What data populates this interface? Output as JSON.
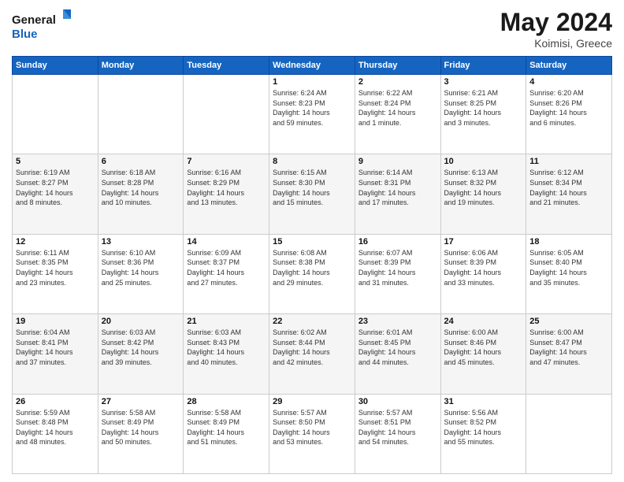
{
  "header": {
    "logo_line1": "General",
    "logo_line2": "Blue",
    "month_year": "May 2024",
    "location": "Koimisi, Greece"
  },
  "weekdays": [
    "Sunday",
    "Monday",
    "Tuesday",
    "Wednesday",
    "Thursday",
    "Friday",
    "Saturday"
  ],
  "weeks": [
    [
      {
        "day": "",
        "info": ""
      },
      {
        "day": "",
        "info": ""
      },
      {
        "day": "",
        "info": ""
      },
      {
        "day": "1",
        "info": "Sunrise: 6:24 AM\nSunset: 8:23 PM\nDaylight: 14 hours\nand 59 minutes."
      },
      {
        "day": "2",
        "info": "Sunrise: 6:22 AM\nSunset: 8:24 PM\nDaylight: 14 hours\nand 1 minute."
      },
      {
        "day": "3",
        "info": "Sunrise: 6:21 AM\nSunset: 8:25 PM\nDaylight: 14 hours\nand 3 minutes."
      },
      {
        "day": "4",
        "info": "Sunrise: 6:20 AM\nSunset: 8:26 PM\nDaylight: 14 hours\nand 6 minutes."
      }
    ],
    [
      {
        "day": "5",
        "info": "Sunrise: 6:19 AM\nSunset: 8:27 PM\nDaylight: 14 hours\nand 8 minutes."
      },
      {
        "day": "6",
        "info": "Sunrise: 6:18 AM\nSunset: 8:28 PM\nDaylight: 14 hours\nand 10 minutes."
      },
      {
        "day": "7",
        "info": "Sunrise: 6:16 AM\nSunset: 8:29 PM\nDaylight: 14 hours\nand 13 minutes."
      },
      {
        "day": "8",
        "info": "Sunrise: 6:15 AM\nSunset: 8:30 PM\nDaylight: 14 hours\nand 15 minutes."
      },
      {
        "day": "9",
        "info": "Sunrise: 6:14 AM\nSunset: 8:31 PM\nDaylight: 14 hours\nand 17 minutes."
      },
      {
        "day": "10",
        "info": "Sunrise: 6:13 AM\nSunset: 8:32 PM\nDaylight: 14 hours\nand 19 minutes."
      },
      {
        "day": "11",
        "info": "Sunrise: 6:12 AM\nSunset: 8:34 PM\nDaylight: 14 hours\nand 21 minutes."
      }
    ],
    [
      {
        "day": "12",
        "info": "Sunrise: 6:11 AM\nSunset: 8:35 PM\nDaylight: 14 hours\nand 23 minutes."
      },
      {
        "day": "13",
        "info": "Sunrise: 6:10 AM\nSunset: 8:36 PM\nDaylight: 14 hours\nand 25 minutes."
      },
      {
        "day": "14",
        "info": "Sunrise: 6:09 AM\nSunset: 8:37 PM\nDaylight: 14 hours\nand 27 minutes."
      },
      {
        "day": "15",
        "info": "Sunrise: 6:08 AM\nSunset: 8:38 PM\nDaylight: 14 hours\nand 29 minutes."
      },
      {
        "day": "16",
        "info": "Sunrise: 6:07 AM\nSunset: 8:39 PM\nDaylight: 14 hours\nand 31 minutes."
      },
      {
        "day": "17",
        "info": "Sunrise: 6:06 AM\nSunset: 8:39 PM\nDaylight: 14 hours\nand 33 minutes."
      },
      {
        "day": "18",
        "info": "Sunrise: 6:05 AM\nSunset: 8:40 PM\nDaylight: 14 hours\nand 35 minutes."
      }
    ],
    [
      {
        "day": "19",
        "info": "Sunrise: 6:04 AM\nSunset: 8:41 PM\nDaylight: 14 hours\nand 37 minutes."
      },
      {
        "day": "20",
        "info": "Sunrise: 6:03 AM\nSunset: 8:42 PM\nDaylight: 14 hours\nand 39 minutes."
      },
      {
        "day": "21",
        "info": "Sunrise: 6:03 AM\nSunset: 8:43 PM\nDaylight: 14 hours\nand 40 minutes."
      },
      {
        "day": "22",
        "info": "Sunrise: 6:02 AM\nSunset: 8:44 PM\nDaylight: 14 hours\nand 42 minutes."
      },
      {
        "day": "23",
        "info": "Sunrise: 6:01 AM\nSunset: 8:45 PM\nDaylight: 14 hours\nand 44 minutes."
      },
      {
        "day": "24",
        "info": "Sunrise: 6:00 AM\nSunset: 8:46 PM\nDaylight: 14 hours\nand 45 minutes."
      },
      {
        "day": "25",
        "info": "Sunrise: 6:00 AM\nSunset: 8:47 PM\nDaylight: 14 hours\nand 47 minutes."
      }
    ],
    [
      {
        "day": "26",
        "info": "Sunrise: 5:59 AM\nSunset: 8:48 PM\nDaylight: 14 hours\nand 48 minutes."
      },
      {
        "day": "27",
        "info": "Sunrise: 5:58 AM\nSunset: 8:49 PM\nDaylight: 14 hours\nand 50 minutes."
      },
      {
        "day": "28",
        "info": "Sunrise: 5:58 AM\nSunset: 8:49 PM\nDaylight: 14 hours\nand 51 minutes."
      },
      {
        "day": "29",
        "info": "Sunrise: 5:57 AM\nSunset: 8:50 PM\nDaylight: 14 hours\nand 53 minutes."
      },
      {
        "day": "30",
        "info": "Sunrise: 5:57 AM\nSunset: 8:51 PM\nDaylight: 14 hours\nand 54 minutes."
      },
      {
        "day": "31",
        "info": "Sunrise: 5:56 AM\nSunset: 8:52 PM\nDaylight: 14 hours\nand 55 minutes."
      },
      {
        "day": "",
        "info": ""
      }
    ]
  ]
}
